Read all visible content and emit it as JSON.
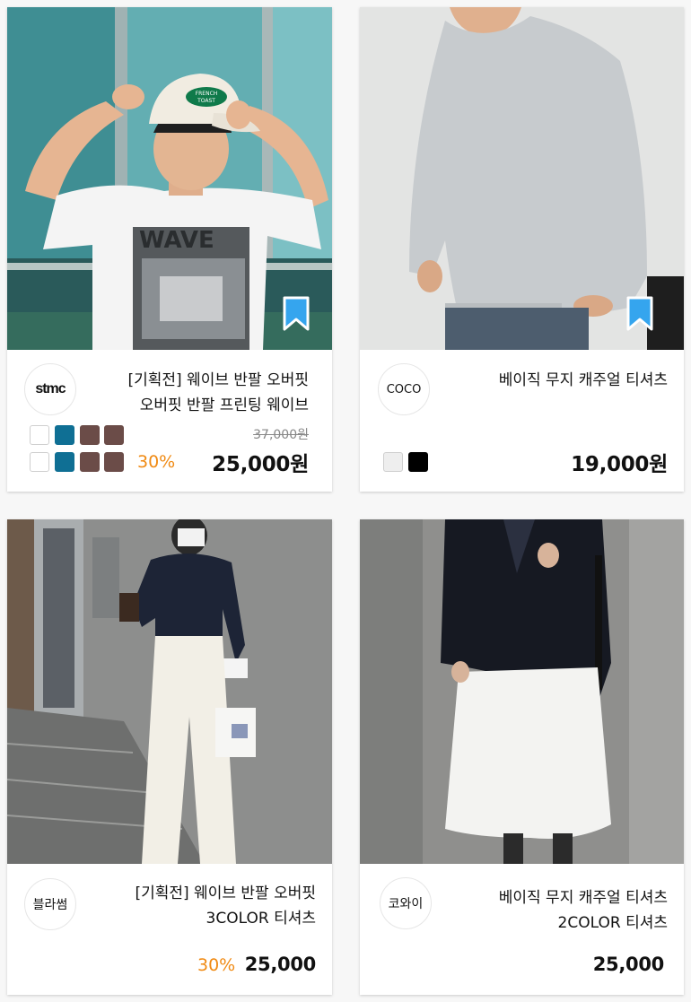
{
  "products": [
    {
      "brand": "stmc",
      "title_lines": [
        "[기획전] 웨이브 반팔 오버핏",
        "오버핏 반팔 프린팅 웨이브"
      ],
      "swatches": [
        [
          "#ffffff",
          "#0f6f94",
          "#6b4c48",
          "#6b4c48"
        ],
        [
          "#ffffff",
          "#0f6f94",
          "#6b4c48",
          "#6b4c48"
        ]
      ],
      "original_price": "37,000원",
      "discount": "30%",
      "price": "25,000원",
      "bookmark_icon": "bookmark-icon",
      "photo": {
        "cap_text": "FRENCH TOAST",
        "shirt_text": "WAVE"
      }
    },
    {
      "brand": "COCO",
      "title_lines": [
        "베이직 무지 캐주얼 티셔츠"
      ],
      "swatches": [
        [
          "#eeeeee",
          "#000000"
        ]
      ],
      "price": "19,000원",
      "bookmark_icon": "bookmark-icon"
    },
    {
      "brand": "블라썸",
      "title_lines": [
        "[기획전] 웨이브 반팔 오버핏",
        "3COLOR 티셔츠"
      ],
      "discount": "30%",
      "price": "25,000"
    },
    {
      "brand": "코와이",
      "title_lines": [
        "베이직 무지 캐주얼 티셔츠",
        "2COLOR 티셔츠"
      ],
      "price": "25,000"
    }
  ],
  "colors": {
    "accent_orange": "#f08a13",
    "bookmark_blue": "#35a5ee"
  }
}
